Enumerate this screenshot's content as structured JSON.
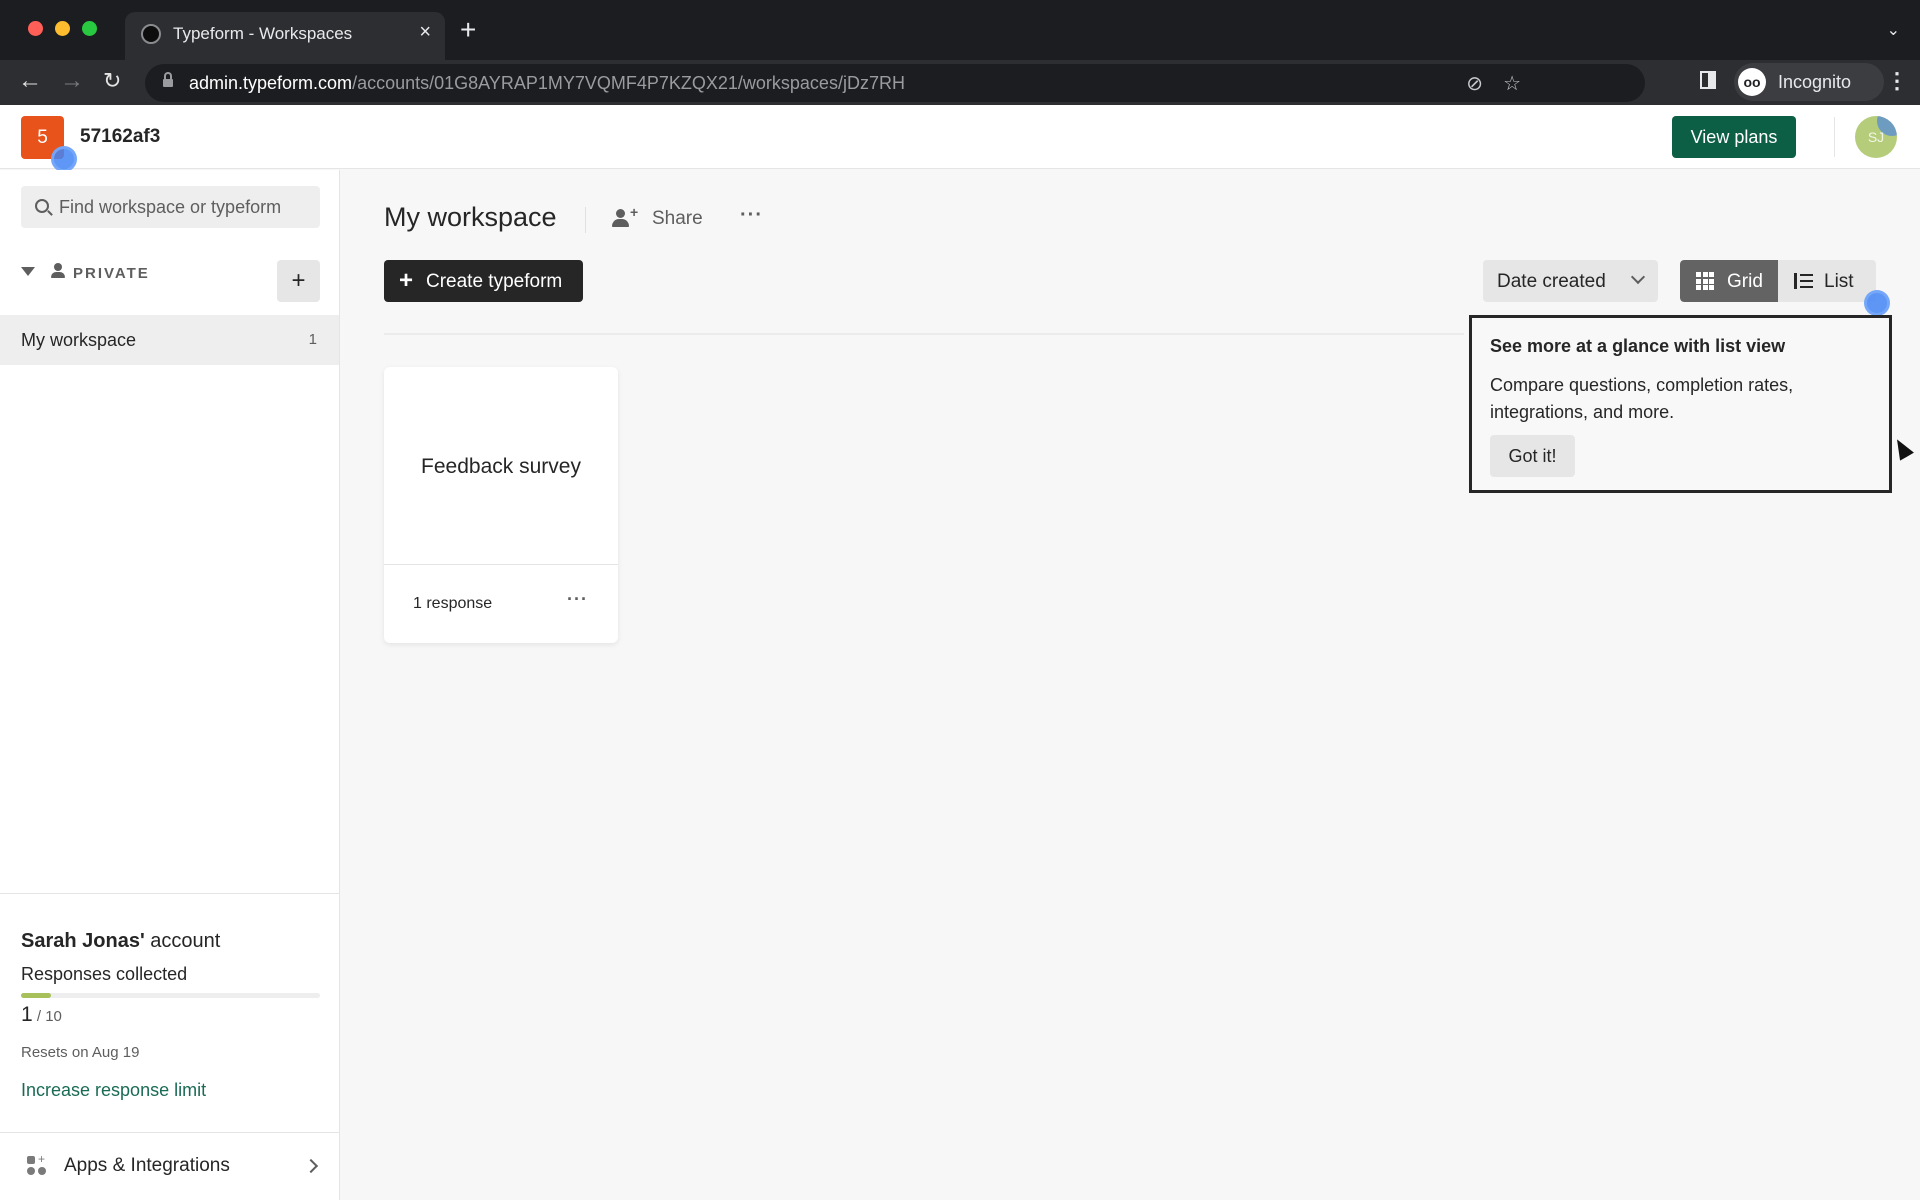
{
  "browser": {
    "tab_title": "Typeform - Workspaces",
    "tab_close": "×",
    "new_tab": "+",
    "tab_list": "⌄",
    "nav_back": "←",
    "nav_forward": "→",
    "nav_reload": "↻",
    "url_host": "admin.typeform.com",
    "url_path": "/accounts/01G8AYRAP1MY7VQMF4P7KZQX21/workspaces/jDz7RH",
    "eye_off_icon": "⊘",
    "star_icon": "☆",
    "incognito_glyph": "oo",
    "incognito_label": "Incognito",
    "menu": "⋮"
  },
  "header": {
    "account_badge": "5",
    "account_name": "57162af3",
    "view_plans": "View plans",
    "user_initials": "SJ"
  },
  "sidebar": {
    "search_placeholder": "Find workspace or typeform",
    "section_label": "PRIVATE",
    "add_button": "+",
    "workspaces": [
      {
        "label": "My workspace",
        "count": "1"
      }
    ],
    "account": {
      "owner_bold": "Sarah Jonas'",
      "owner_suffix": " account",
      "responses_label": "Responses collected",
      "responses_used": 1,
      "responses_limit": 10,
      "responses_used_text": "1",
      "responses_limit_text": " / 10",
      "resets": "Resets on Aug 19",
      "increase_link": "Increase response limit"
    },
    "apps_label": "Apps & Integrations"
  },
  "main": {
    "workspace_title": "My workspace",
    "share_label": "Share",
    "more_label": "···",
    "create_plus": "+",
    "create_label": "Create typeform",
    "sort_label": "Date created",
    "view_grid": "Grid",
    "view_list": "List",
    "active_view": "Grid",
    "forms": [
      {
        "title": "Feedback survey",
        "responses": "1 response",
        "more": "···"
      }
    ]
  },
  "tooltip": {
    "title": "See more at a glance with list view",
    "body": "Compare questions, completion rates, integrations, and more.",
    "button": "Got it!"
  }
}
